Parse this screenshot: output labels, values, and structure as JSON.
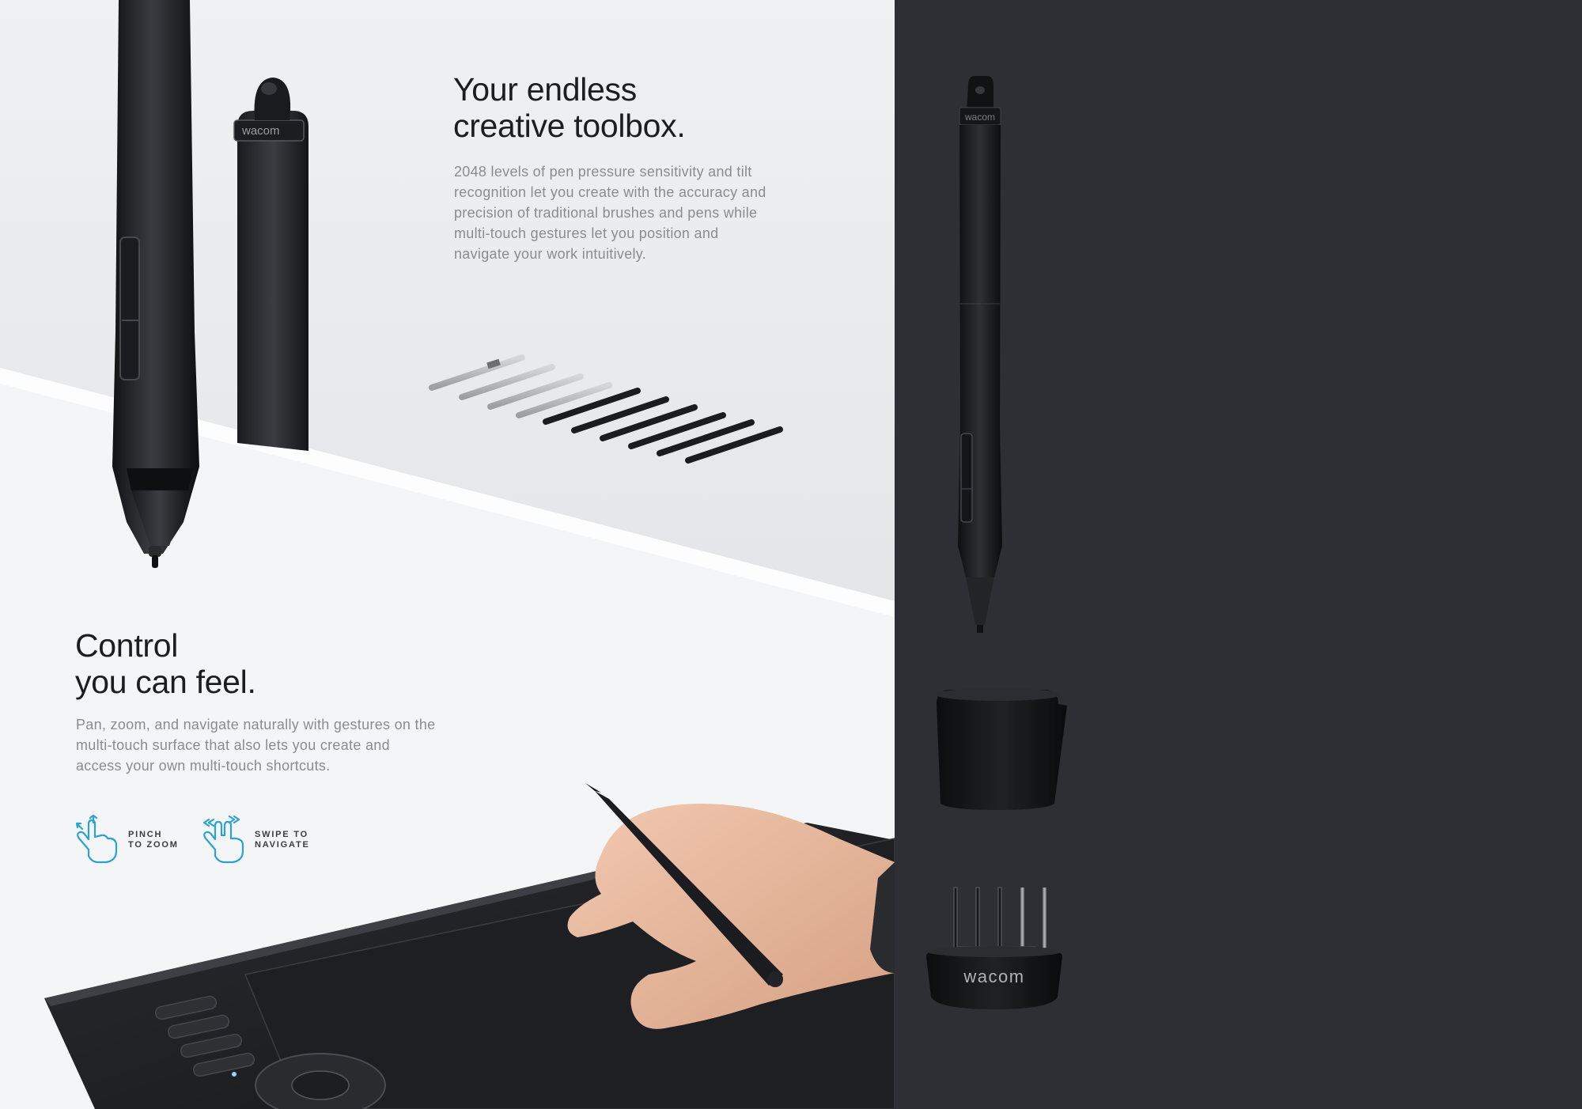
{
  "toolbox": {
    "title_line1": "Your endless",
    "title_line2": "creative toolbox.",
    "description": "2048 levels of pen pressure sensitivity and tilt recognition let you create with the accuracy and precision of traditional brushes and pens while multi-touch gestures let you position and navigate your work intuitively."
  },
  "control": {
    "title_line1": "Control",
    "title_line2": "you can feel.",
    "description": "Pan, zoom, and navigate naturally with gestures on the multi-touch surface that also lets you create and access your own multi-touch shortcuts."
  },
  "gestures": [
    {
      "icon": "pinch-gesture-icon",
      "label_line1": "PINCH",
      "label_line2": "TO ZOOM"
    },
    {
      "icon": "swipe-gesture-icon",
      "label_line1": "SWIPE TO",
      "label_line2": "NAVIGATE"
    }
  ],
  "brand": {
    "pen_logo": "wacom",
    "pen_stand_logo": "wacom"
  },
  "colors": {
    "dark_panel": "#2e2f34",
    "gesture_accent": "#29a3d6",
    "heading_text": "#1d1d1f",
    "body_text": "#8a8c90"
  }
}
